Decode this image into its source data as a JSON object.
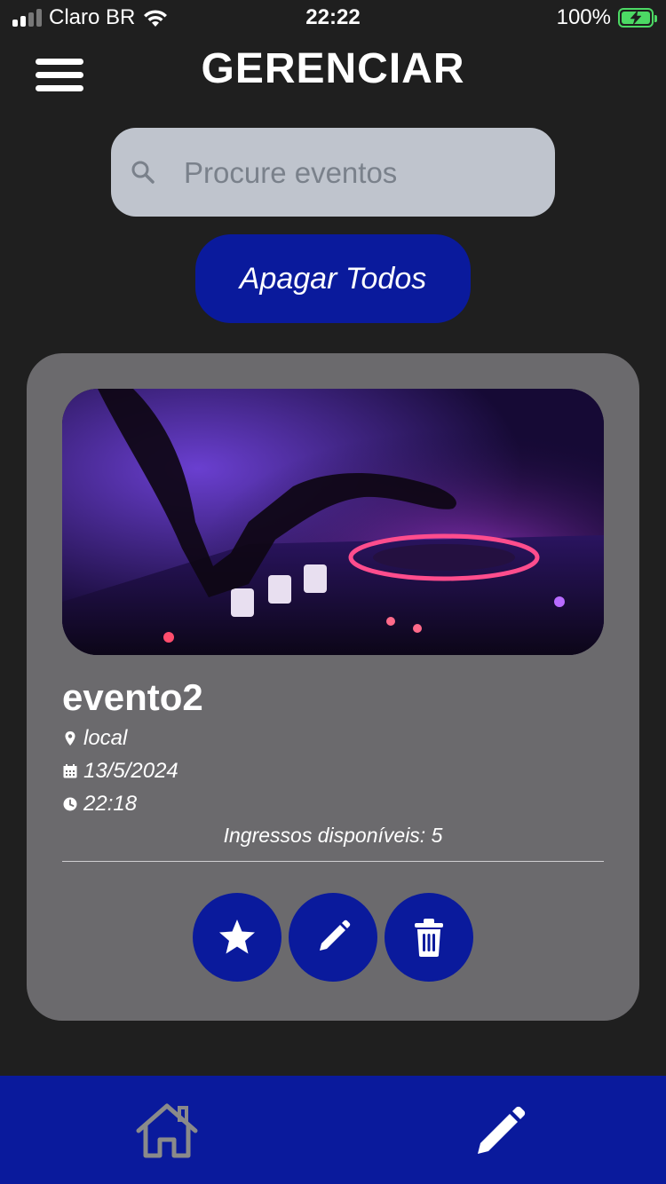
{
  "status_bar": {
    "carrier": "Claro BR",
    "time": "22:22",
    "battery": "100%",
    "battery_color": "#4cd964"
  },
  "header": {
    "title": "GERENCIAR",
    "menu_icon": "hamburger-menu-icon"
  },
  "search": {
    "placeholder": "Procure eventos",
    "value": "",
    "icon": "search-icon"
  },
  "delete_all": {
    "label": "Apagar Todos"
  },
  "events": [
    {
      "name": "evento2",
      "location": "local",
      "date": "13/5/2024",
      "time": "22:18",
      "tickets_label": "Ingressos disponíveis: 5",
      "actions": [
        "star-icon",
        "pencil-icon",
        "trash-icon"
      ]
    }
  ],
  "bottom_nav": {
    "items": [
      "home-icon",
      "pencil-icon"
    ]
  },
  "colors": {
    "background": "#1f1f1f",
    "accent": "#0a1a9c",
    "card": "#6b6a6d",
    "search_bg": "#bfc4cd"
  }
}
